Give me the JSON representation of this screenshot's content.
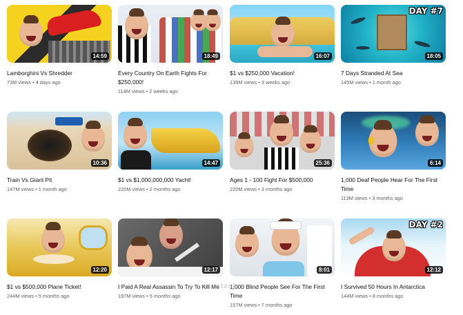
{
  "videos": [
    {
      "title": "Lamborghini Vs Shredder",
      "views": "73M views",
      "age": "4 days ago",
      "duration": "14:59",
      "badge": ""
    },
    {
      "title": "Every Country On Earth Fights For $250,000!",
      "views": "114M views",
      "age": "2 weeks ago",
      "duration": "18:49",
      "badge": ""
    },
    {
      "title": "$1 vs $250,000 Vacation!",
      "views": "139M views",
      "age": "3 weeks ago",
      "duration": "16:07",
      "badge": ""
    },
    {
      "title": "7 Days Stranded At Sea",
      "views": "145M views",
      "age": "1 month ago",
      "duration": "18:05",
      "badge": "DAY #7"
    },
    {
      "title": "Train Vs Giant Pit",
      "views": "147M views",
      "age": "1 month ago",
      "duration": "10:36",
      "badge": ""
    },
    {
      "title": "$1 vs $1,000,000,000 Yacht!",
      "views": "220M views",
      "age": "2 months ago",
      "duration": "14:47",
      "badge": ""
    },
    {
      "title": "Ages 1 - 100 Fight For $500,000",
      "views": "220M views",
      "age": "3 months ago",
      "duration": "25:36",
      "badge": ""
    },
    {
      "title": "1,000 Deaf People Hear For The First Time",
      "views": "113M views",
      "age": "3 months ago",
      "duration": "6:14",
      "badge": ""
    },
    {
      "title": "$1 vs $500,000 Plane Ticket!",
      "views": "244M views",
      "age": "5 months ago",
      "duration": "12:20",
      "badge": ""
    },
    {
      "title": "I Paid A Real Assassin To Try To Kill Me",
      "views": "197M views",
      "age": "5 months ago",
      "duration": "12:17",
      "badge": ""
    },
    {
      "title": "1,000 Blind People See For The First Time",
      "views": "157M views",
      "age": "7 months ago",
      "duration": "8:01",
      "badge": ""
    },
    {
      "title": "I Survived 50 Hours In Antarctica",
      "views": "144M views",
      "age": "8 months ago",
      "duration": "12:12",
      "badge": "DAY #2"
    }
  ],
  "watermark": "mostaql",
  "colors": {
    "title": "#0f0f0f",
    "meta": "#606060",
    "duration_bg": "#000000"
  }
}
